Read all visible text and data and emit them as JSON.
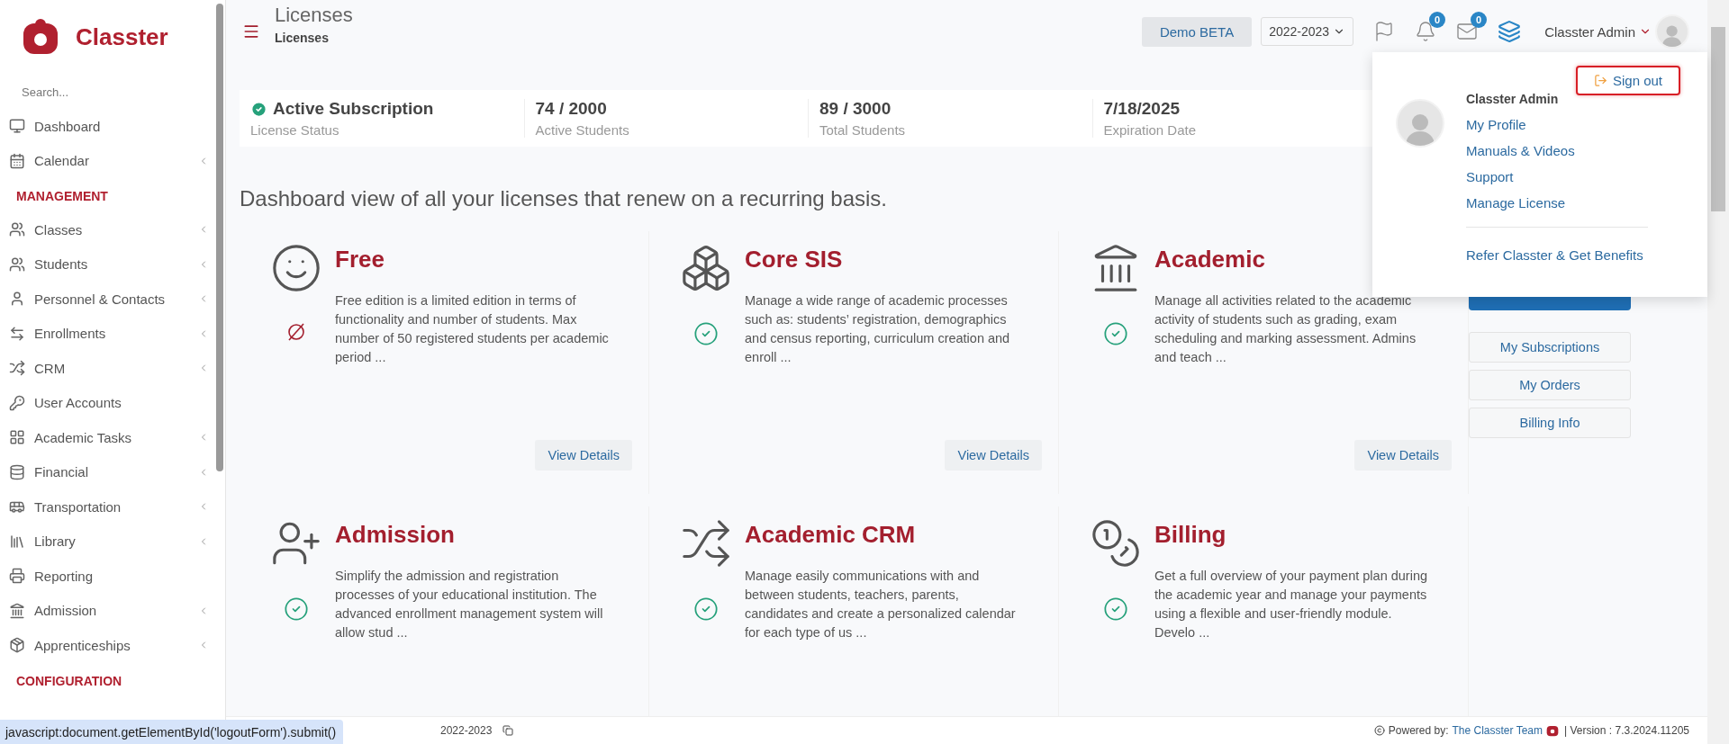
{
  "sidebar": {
    "brand": "Classter",
    "search": {
      "placeholder": "Search..."
    },
    "sections": [
      {
        "items": [
          {
            "label": "Dashboard",
            "expandable": false
          },
          {
            "label": "Calendar",
            "expandable": true
          }
        ]
      },
      {
        "heading": "MANAGEMENT",
        "items": [
          {
            "label": "Classes",
            "expandable": true
          },
          {
            "label": "Students",
            "expandable": true
          },
          {
            "label": "Personnel & Contacts",
            "expandable": true
          },
          {
            "label": "Enrollments",
            "expandable": true
          },
          {
            "label": "CRM",
            "expandable": true
          },
          {
            "label": "User Accounts",
            "expandable": false
          },
          {
            "label": "Academic Tasks",
            "expandable": true
          },
          {
            "label": "Financial",
            "expandable": true
          },
          {
            "label": "Transportation",
            "expandable": true
          },
          {
            "label": "Library",
            "expandable": true
          },
          {
            "label": "Reporting",
            "expandable": false
          },
          {
            "label": "Admission",
            "expandable": true
          },
          {
            "label": "Apprenticeships",
            "expandable": true
          }
        ]
      },
      {
        "heading": "CONFIGURATION"
      }
    ]
  },
  "header": {
    "title": "Licenses",
    "breadcrumb": "Licenses",
    "demo_button": "Demo BETA",
    "year_select": "2022-2023",
    "notifications_badge": "0",
    "messages_badge": "0",
    "user_name": "Classter Admin"
  },
  "user_menu": {
    "sign_out": {
      "label": "Sign out",
      "highlighted": true
    },
    "name": "Classter Admin",
    "links": [
      "My Profile",
      "Manuals & Videos",
      "Support",
      "Manage License"
    ],
    "refer_link": "Refer Classter & Get Benefits"
  },
  "stats": [
    {
      "value": "Active Subscription",
      "label": "License Status",
      "kind": "status"
    },
    {
      "value": "74 / 2000",
      "label": "Active Students",
      "kind": "plain"
    },
    {
      "value": "89 / 3000",
      "label": "Total Students",
      "kind": "plain"
    },
    {
      "value": "7/18/2025",
      "label": "Expiration Date",
      "kind": "plain"
    }
  ],
  "intro": "Dashboard view of all your licenses that renew on a recurring basis.",
  "licenses": [
    {
      "title": "Free",
      "description": "Free edition is a limited edition in terms of functionality and number of students. Max number of 50 registered students per academic period ...",
      "included": false,
      "button": "View Details"
    },
    {
      "title": "Core SIS",
      "description": "Manage a wide range of academic processes such as: students’ registration, demographics and census reporting, curriculum creation and enroll ...",
      "included": true,
      "button": "View Details"
    },
    {
      "title": "Academic",
      "description": "Manage all activities related to the academic activity of students such as grading, exam scheduling and marking assessment. Admins and teach ...",
      "included": true,
      "button": "View Details"
    },
    {
      "title": "Admission",
      "description": "Simplify the admission and registration processes of your educational institution. The advanced enrollment management system will allow stud ...",
      "included": true
    },
    {
      "title": "Academic CRM",
      "description": "Manage easily communications with and between students, teachers, parents, candidates and create a personalized calendar for each type of us ...",
      "included": true
    },
    {
      "title": "Billing",
      "description": "Get a full overview of your payment plan during the academic year and manage your payments using a flexible and user-friendly module. Develo ...",
      "included": true
    }
  ],
  "side_buttons": [
    "My Subscriptions",
    "My Orders",
    "Billing Info"
  ],
  "footer": {
    "year": "2022-2023",
    "powered_label": "Powered by:",
    "team_link": "The Classter Team",
    "version": "| Version : 7.3.2024.11205"
  },
  "status_url": "javascript:document.getElementById('logoutForm').submit()"
}
